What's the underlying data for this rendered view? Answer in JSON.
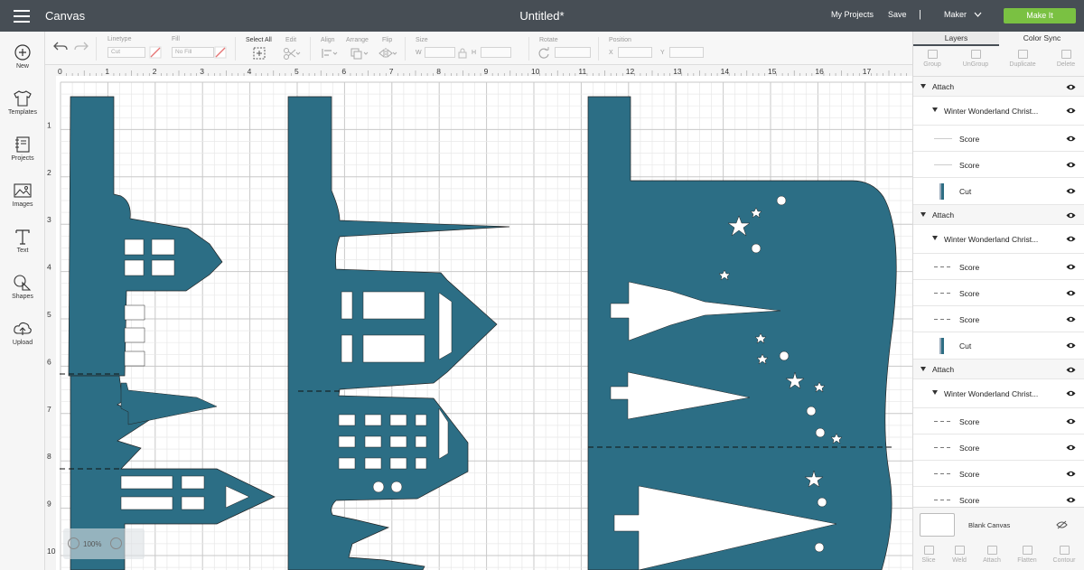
{
  "topbar": {
    "app_title": "Canvas",
    "doc_title": "Untitled*",
    "my_projects": "My Projects",
    "save": "Save",
    "separator": "|",
    "machine": "Maker",
    "make_it": "Make It",
    "accent_color": "#7ac142"
  },
  "sidebar": {
    "items": [
      {
        "label": "New",
        "icon": "plus-circle-icon"
      },
      {
        "label": "Templates",
        "icon": "tshirt-icon"
      },
      {
        "label": "Projects",
        "icon": "notebook-icon"
      },
      {
        "label": "Images",
        "icon": "image-icon"
      },
      {
        "label": "Text",
        "icon": "text-icon"
      },
      {
        "label": "Shapes",
        "icon": "shapes-icon"
      },
      {
        "label": "Upload",
        "icon": "cloud-upload-icon"
      }
    ]
  },
  "toolbar": {
    "linetype_label": "Linetype",
    "linetype_value": "Cut",
    "fill_label": "Fill",
    "fill_value": "No Fill",
    "select_all": "Select All",
    "edit": "Edit",
    "align": "Align",
    "arrange": "Arrange",
    "flip": "Flip",
    "size": "Size",
    "size_w": "W",
    "size_h": "H",
    "rotate": "Rotate",
    "position": "Position",
    "pos_x": "X",
    "pos_y": "Y"
  },
  "rulers": {
    "top": [
      "0",
      "1",
      "2",
      "3",
      "4",
      "5",
      "6",
      "7",
      "8",
      "9",
      "10",
      "11",
      "12",
      "13",
      "14",
      "15",
      "16",
      "17"
    ],
    "left": [
      "1",
      "2",
      "3",
      "4",
      "5",
      "6",
      "7",
      "8",
      "9",
      "10"
    ]
  },
  "canvas": {
    "shape_color": "#2c6e85",
    "zoom": "100%"
  },
  "panel": {
    "tabs": [
      "Layers",
      "Color Sync"
    ],
    "tools": [
      "Group",
      "UnGroup",
      "Duplicate",
      "Delete"
    ],
    "layers": [
      {
        "label": "Attach",
        "kind": "group"
      },
      {
        "label": "Winter Wonderland Christ...",
        "kind": "sub"
      },
      {
        "label": "Score",
        "kind": "score"
      },
      {
        "label": "Score",
        "kind": "score"
      },
      {
        "label": "Cut",
        "kind": "cut"
      },
      {
        "label": "Attach",
        "kind": "group"
      },
      {
        "label": "Winter Wonderland Christ...",
        "kind": "sub"
      },
      {
        "label": "Score",
        "kind": "dscore"
      },
      {
        "label": "Score",
        "kind": "dscore"
      },
      {
        "label": "Score",
        "kind": "dscore"
      },
      {
        "label": "Cut",
        "kind": "cut"
      },
      {
        "label": "Attach",
        "kind": "group"
      },
      {
        "label": "Winter Wonderland Christ...",
        "kind": "sub"
      },
      {
        "label": "Score",
        "kind": "dscore"
      },
      {
        "label": "Score",
        "kind": "dscore"
      },
      {
        "label": "Score",
        "kind": "dscore"
      },
      {
        "label": "Score",
        "kind": "dscore"
      }
    ],
    "blank_canvas": "Blank Canvas",
    "bottom_tools": [
      "Slice",
      "Weld",
      "Attach",
      "Flatten",
      "Contour"
    ]
  }
}
